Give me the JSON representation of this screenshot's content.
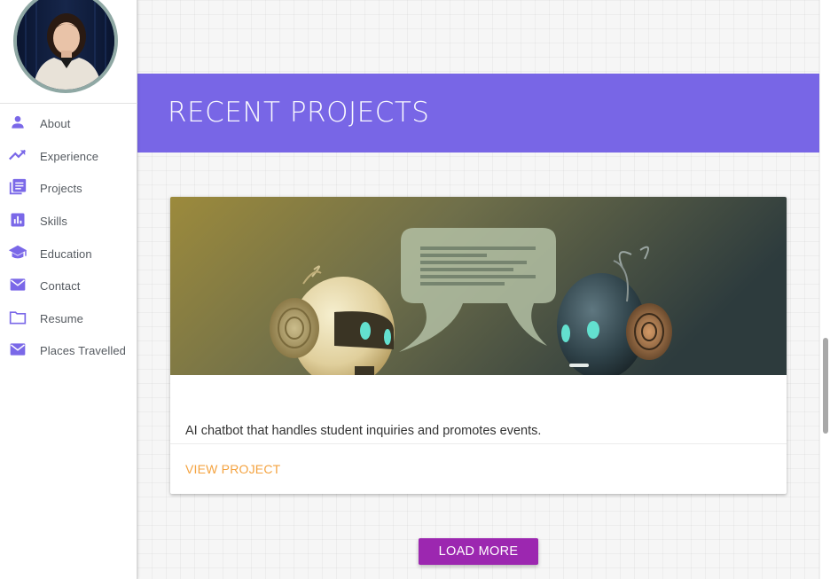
{
  "sidebar": {
    "items": [
      {
        "label": "About",
        "icon": "person-icon"
      },
      {
        "label": "Experience",
        "icon": "trending-up-icon"
      },
      {
        "label": "Projects",
        "icon": "library-books-icon"
      },
      {
        "label": "Skills",
        "icon": "bar-chart-icon"
      },
      {
        "label": "Education",
        "icon": "graduation-cap-icon"
      },
      {
        "label": "Contact",
        "icon": "mail-icon"
      },
      {
        "label": "Resume",
        "icon": "folder-icon"
      },
      {
        "label": "Places Travelled",
        "icon": "mail-icon"
      }
    ],
    "icon_color": "#7a68e8"
  },
  "main": {
    "section_title": "RECENT PROJECTS",
    "banner_color": "#7866e6",
    "project": {
      "description": "AI chatbot that handles student inquiries and promotes events.",
      "link_label": "VIEW PROJECT",
      "link_color": "#f4a340"
    },
    "load_more_label": "LOAD MORE",
    "load_more_color": "#9c27b0"
  }
}
